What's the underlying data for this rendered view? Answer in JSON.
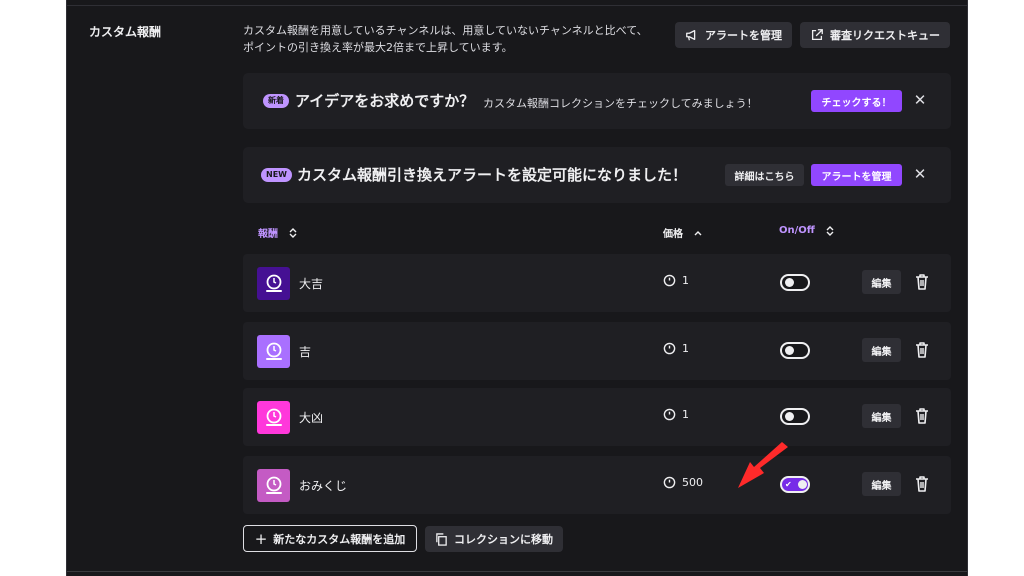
{
  "section": {
    "title": "カスタム報酬",
    "description_line1": "カスタム報酬を用意しているチャンネルは、用意していないチャンネルと比べて、",
    "description_line2": "ポイントの引き換え率が最大2倍まで上昇しています。"
  },
  "toolbar": {
    "manage_alerts_label": "アラートを管理",
    "review_queue_label": "審査リクエストキュー"
  },
  "banners": [
    {
      "badge": "新着",
      "title": "アイデアをお求めですか？",
      "subtitle": "カスタム報酬コレクションをチェックしてみましょう！",
      "action_label": "チェックする！",
      "close_label": "✕"
    },
    {
      "badge": "NEW",
      "title": "カスタム報酬引き換えアラートを設定可能になりました！",
      "details_label": "詳細はこちら",
      "action_label": "アラートを管理",
      "close_label": "✕"
    }
  ],
  "table": {
    "headers": {
      "name": "報酬",
      "price": "価格",
      "onoff": "On/Off"
    },
    "rows": [
      {
        "name": "大吉",
        "price": "1",
        "enabled": false,
        "thumb_color": "#451093",
        "edit_label": "編集"
      },
      {
        "name": "吉",
        "price": "1",
        "enabled": false,
        "thumb_color": "#a970ff",
        "edit_label": "編集"
      },
      {
        "name": "大凶",
        "price": "1",
        "enabled": false,
        "thumb_color": "#ff38db",
        "edit_label": "編集"
      },
      {
        "name": "おみくじ",
        "price": "500",
        "enabled": true,
        "thumb_color": "#c45bc4",
        "edit_label": "編集"
      }
    ]
  },
  "footer": {
    "add_label": "新たなカスタム報酬を追加",
    "collection_label": "コレクションに移動"
  },
  "colors": {
    "accent": "#9147ff",
    "accent_light": "#bf94ff",
    "annotation_arrow": "#ff2a2a"
  }
}
